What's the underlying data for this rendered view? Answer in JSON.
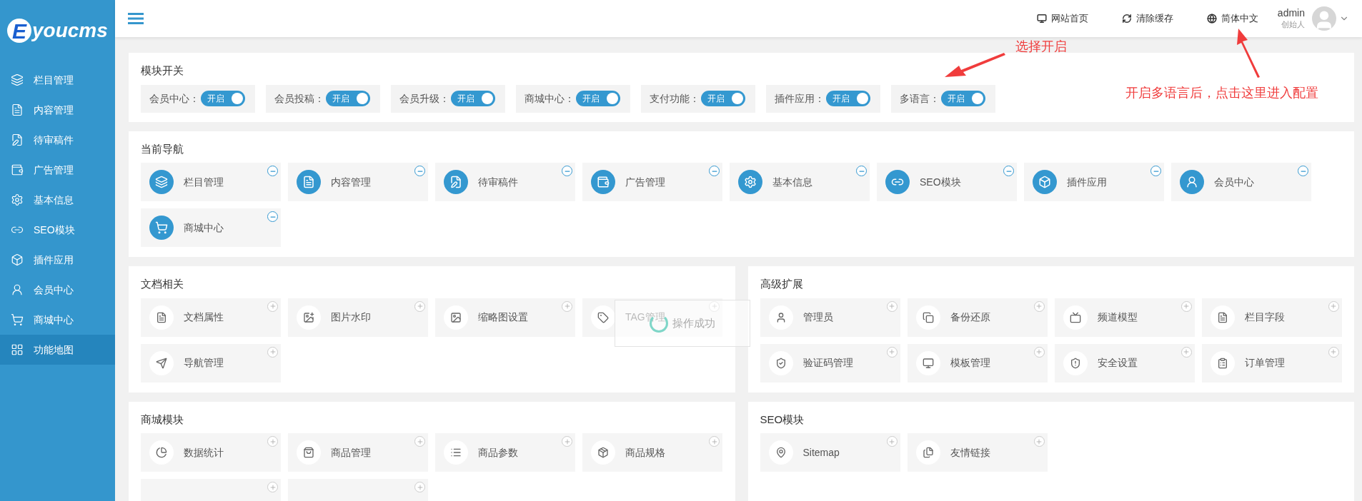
{
  "sidebar": {
    "logo": {
      "letter": "E",
      "text": "youcms"
    },
    "items": [
      {
        "label": "栏目管理",
        "selected": false
      },
      {
        "label": "内容管理",
        "selected": false
      },
      {
        "label": "待审稿件",
        "selected": false
      },
      {
        "label": "广告管理",
        "selected": false
      },
      {
        "label": "基本信息",
        "selected": false
      },
      {
        "label": "SEO模块",
        "selected": false
      },
      {
        "label": "插件应用",
        "selected": false
      },
      {
        "label": "会员中心",
        "selected": false
      },
      {
        "label": "商城中心",
        "selected": false
      },
      {
        "label": "功能地图",
        "selected": true
      }
    ]
  },
  "header": {
    "links": [
      "网站首页",
      "清除缓存",
      "简体中文"
    ],
    "user": {
      "name": "admin",
      "role": "创始人"
    }
  },
  "module_switches": {
    "title": "模块开关",
    "items": [
      {
        "label": "会员中心：",
        "state": "开启",
        "on": true
      },
      {
        "label": "会员投稿：",
        "state": "开启",
        "on": true
      },
      {
        "label": "会员升级：",
        "state": "开启",
        "on": true
      },
      {
        "label": "商城中心：",
        "state": "开启",
        "on": true
      },
      {
        "label": "支付功能：",
        "state": "开启",
        "on": true
      },
      {
        "label": "插件应用：",
        "state": "开启",
        "on": true
      },
      {
        "label": "多语言：",
        "state": "开启",
        "on": true
      }
    ]
  },
  "current_nav": {
    "title": "当前导航",
    "items": [
      "栏目管理",
      "内容管理",
      "待审稿件",
      "广告管理",
      "基本信息",
      "SEO模块",
      "插件应用",
      "会员中心",
      "商城中心"
    ]
  },
  "sections": [
    {
      "title": "文档相关",
      "items": [
        {
          "label": "文档属性"
        },
        {
          "label": "图片水印"
        },
        {
          "label": "缩略图设置"
        },
        {
          "label": "TAG管理"
        },
        {
          "label": "导航管理"
        }
      ]
    },
    {
      "title": "高级扩展",
      "items": [
        {
          "label": "管理员"
        },
        {
          "label": "备份还原"
        },
        {
          "label": "频道模型"
        },
        {
          "label": "栏目字段"
        },
        {
          "label": "验证码管理"
        },
        {
          "label": "模板管理"
        },
        {
          "label": "安全设置"
        },
        {
          "label": "订单管理"
        }
      ]
    },
    {
      "title": "商城模块",
      "items": [
        {
          "label": "数据统计"
        },
        {
          "label": "商品管理"
        },
        {
          "label": "商品参数"
        },
        {
          "label": "商品规格"
        },
        {
          "kind": "cut"
        },
        {
          "kind": "cut"
        }
      ]
    },
    {
      "title": "SEO模块",
      "items": [
        {
          "label": "Sitemap"
        },
        {
          "label": "友情链接"
        }
      ]
    }
  ],
  "toast": "操作成功",
  "annotations": [
    "选择开启",
    "开启多语言后，点击这里进入配置"
  ]
}
